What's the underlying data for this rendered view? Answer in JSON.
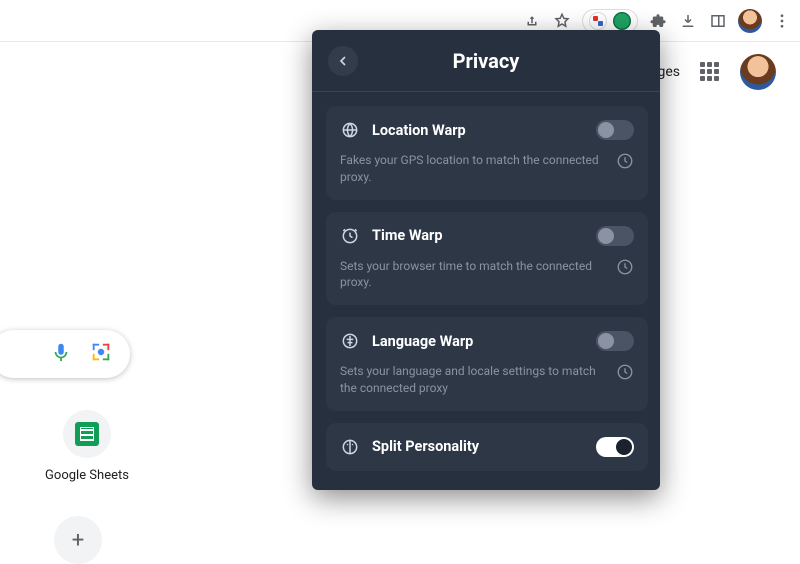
{
  "chrome": {
    "header_link_images": "Images"
  },
  "shortcut": {
    "sheets_label": "Google Sheets"
  },
  "popup": {
    "title": "Privacy",
    "features": [
      {
        "title": "Location Warp",
        "desc": "Fakes your GPS location to match the connected proxy.",
        "on": false
      },
      {
        "title": "Time Warp",
        "desc": "Sets your browser time to match the connected proxy.",
        "on": false
      },
      {
        "title": "Language Warp",
        "desc": "Sets your language and locale settings to match the connected proxy",
        "on": false
      },
      {
        "title": "Split Personality",
        "desc": "",
        "on": true
      }
    ]
  }
}
